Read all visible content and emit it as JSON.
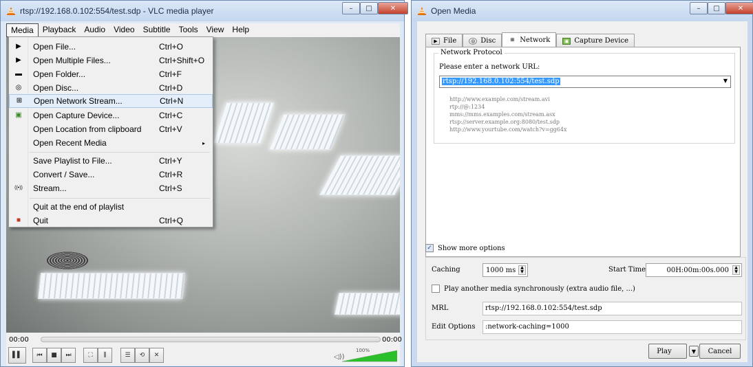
{
  "vlc": {
    "title": "rtsp://192.168.0.102:554/test.sdp - VLC media player",
    "window_buttons": [
      "–",
      "□",
      "✕"
    ],
    "menu": [
      "Media",
      "Playback",
      "Audio",
      "Video",
      "Subtitle",
      "Tools",
      "View",
      "Help"
    ],
    "media_menu": [
      {
        "label": "Open File...",
        "shortcut": "Ctrl+O",
        "icon": "▶"
      },
      {
        "label": "Open Multiple Files...",
        "shortcut": "Ctrl+Shift+O",
        "icon": "▶"
      },
      {
        "label": "Open Folder...",
        "shortcut": "Ctrl+F",
        "icon": "▬"
      },
      {
        "label": "Open Disc...",
        "shortcut": "Ctrl+D",
        "icon": "◎"
      },
      {
        "label": "Open Network Stream...",
        "shortcut": "Ctrl+N",
        "icon": "⊞"
      },
      {
        "label": "Open Capture Device...",
        "shortcut": "Ctrl+C",
        "icon": "▣"
      },
      {
        "label": "Open Location from clipboard",
        "shortcut": "Ctrl+V",
        "icon": ""
      },
      {
        "label": "Open Recent Media",
        "shortcut": "",
        "icon": ""
      },
      {
        "label": "Save Playlist to File...",
        "shortcut": "Ctrl+Y",
        "icon": ""
      },
      {
        "label": "Convert / Save...",
        "shortcut": "Ctrl+R",
        "icon": ""
      },
      {
        "label": "Stream...",
        "shortcut": "Ctrl+S",
        "icon": "((•))"
      },
      {
        "label": "Quit at the end of playlist",
        "shortcut": "",
        "icon": ""
      },
      {
        "label": "Quit",
        "shortcut": "Ctrl+Q",
        "icon": "■"
      }
    ],
    "submenu_arrow": "▸",
    "time_elapsed": "00:00",
    "time_total": "00:00",
    "controls": [
      "▌▌",
      "⏮",
      "■",
      "⏭",
      "⛶",
      "⫼",
      "☰",
      "⟲",
      "✕"
    ],
    "volume_icon": "◁))",
    "volume_label": "100%",
    "volume_level": 1.0,
    "accent_color": "#2bbf2b"
  },
  "dialog": {
    "title": "Open Media",
    "window_buttons": [
      "–",
      "□",
      "✕"
    ],
    "tabs": [
      {
        "label": "File",
        "icon": "▶"
      },
      {
        "label": "Disc",
        "icon": "◎"
      },
      {
        "label": "Network",
        "icon": "⊞"
      },
      {
        "label": "Capture Device",
        "icon": "▣"
      }
    ],
    "group_title": "Network Protocol",
    "url_prompt": "Please enter a network URL:",
    "url_value": "rtsp://192.168.0.102:554/test.sdp",
    "dropdown_arrow": "▼",
    "examples": [
      "http://www.example.com/stream.avi",
      "rtp://@:1234",
      "mms://mms.examples.com/stream.asx",
      "rtsp://server.example.org:8080/test.sdp",
      "http://www.yourtube.com/watch?v=gg64x"
    ],
    "show_more_label": "Show more options",
    "show_more_checked": true,
    "check_mark": "✓",
    "caching_label": "Caching",
    "caching_value": "1000 ms",
    "start_time_label": "Start Time",
    "start_time_value": "00H:00m:00s.000",
    "play_another_label": "Play another media synchronously (extra audio file, ...)",
    "mrl_label": "MRL",
    "mrl_value": "rtsp://192.168.0.102:554/test.sdp",
    "edit_options_label": "Edit Options",
    "edit_options_value": ":network-caching=1000",
    "play_button": "Play",
    "play_dropdown": "▼",
    "cancel_button": "Cancel"
  }
}
